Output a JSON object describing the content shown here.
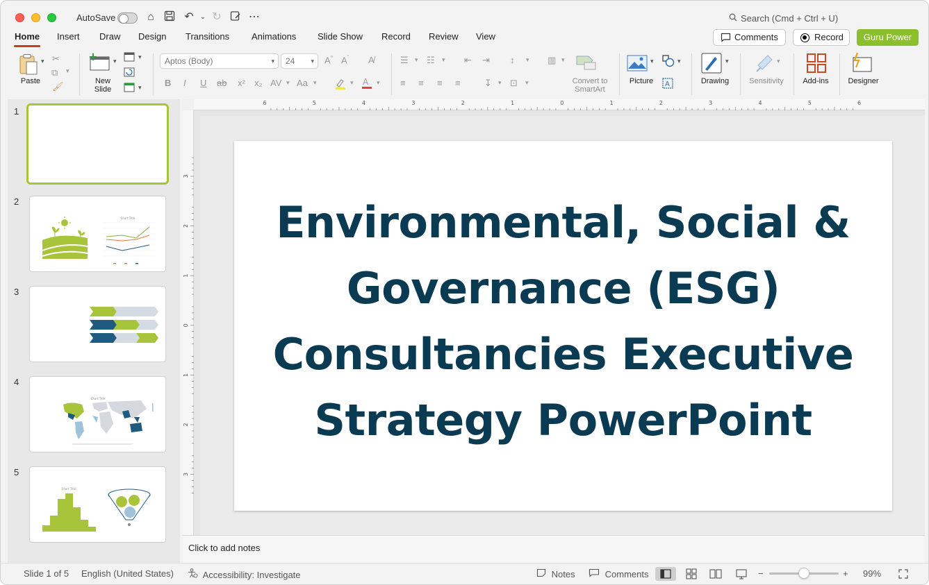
{
  "titlebar": {
    "autosave_label": "AutoSave",
    "search_placeholder": "Search (Cmd + Ctrl + U)"
  },
  "tabs": [
    {
      "label": "Home",
      "active": true
    },
    {
      "label": "Insert"
    },
    {
      "label": "Draw"
    },
    {
      "label": "Design"
    },
    {
      "label": "Transitions"
    },
    {
      "label": "Animations"
    },
    {
      "label": "Slide Show"
    },
    {
      "label": "Record"
    },
    {
      "label": "Review"
    },
    {
      "label": "View"
    }
  ],
  "header_buttons": {
    "comments": "Comments",
    "record": "Record",
    "guru": "Guru Power"
  },
  "ribbon": {
    "paste": "Paste",
    "new_slide_line1": "New",
    "new_slide_line2": "Slide",
    "font_name": "Aptos (Body)",
    "font_size": "24",
    "convert_line1": "Convert to",
    "convert_line2": "SmartArt",
    "picture": "Picture",
    "drawing": "Drawing",
    "sensitivity": "Sensitivity",
    "addins": "Add-ins",
    "designer": "Designer"
  },
  "slides": [
    {
      "number": "1"
    },
    {
      "number": "2",
      "chart_title": "Chart Title"
    },
    {
      "number": "3"
    },
    {
      "number": "4",
      "chart_title": "Chart Title"
    },
    {
      "number": "5",
      "chart_title": "Chart Title"
    }
  ],
  "main_slide": {
    "title": "Environmental, Social & Governance (ESG) Consultancies Executive Strategy PowerPoint"
  },
  "ruler": {
    "top_labels": [
      "6",
      "5",
      "4",
      "3",
      "2",
      "1",
      "0",
      "1",
      "2",
      "3",
      "4",
      "5",
      "6"
    ],
    "left_labels": [
      "3",
      "2",
      "1",
      "0",
      "1",
      "2",
      "3"
    ]
  },
  "notes_placeholder": "Click to add notes",
  "status": {
    "slide_counter": "Slide 1 of 5",
    "language": "English (United States)",
    "accessibility": "Accessibility: Investigate",
    "notes": "Notes",
    "comments": "Comments",
    "zoom": "99%"
  },
  "colors": {
    "title_text": "#0b3a53",
    "accent_green": "#a8c43a",
    "accent_navy": "#1f5a7f",
    "active_tab": "#c43e1c"
  }
}
